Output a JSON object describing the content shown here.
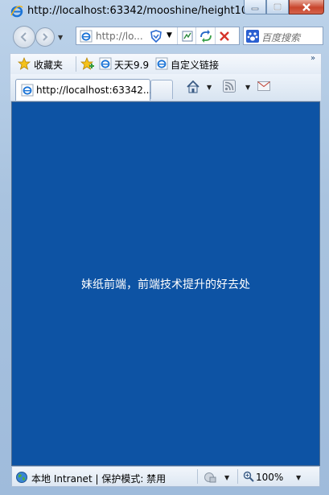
{
  "window": {
    "title": "http://localhost:63342/mooshine/height10...",
    "minimize_icon": "minimize-icon",
    "maximize_icon": "maximize-icon",
    "close_icon": "close-icon"
  },
  "navigation": {
    "address_text": "http://lo...",
    "search_placeholder": "百度搜索"
  },
  "favorites": {
    "label": "收藏夹",
    "items": [
      {
        "label": "天天9.9"
      },
      {
        "label": "自定义链接"
      }
    ]
  },
  "tabs": [
    {
      "label": "http://localhost:63342..."
    }
  ],
  "content": {
    "message": "妹纸前端，前端技术提升的好去处",
    "background": "#0d53a4"
  },
  "status": {
    "zone_text": "本地 Intranet | 保护模式: 禁用",
    "zoom": "100%"
  }
}
